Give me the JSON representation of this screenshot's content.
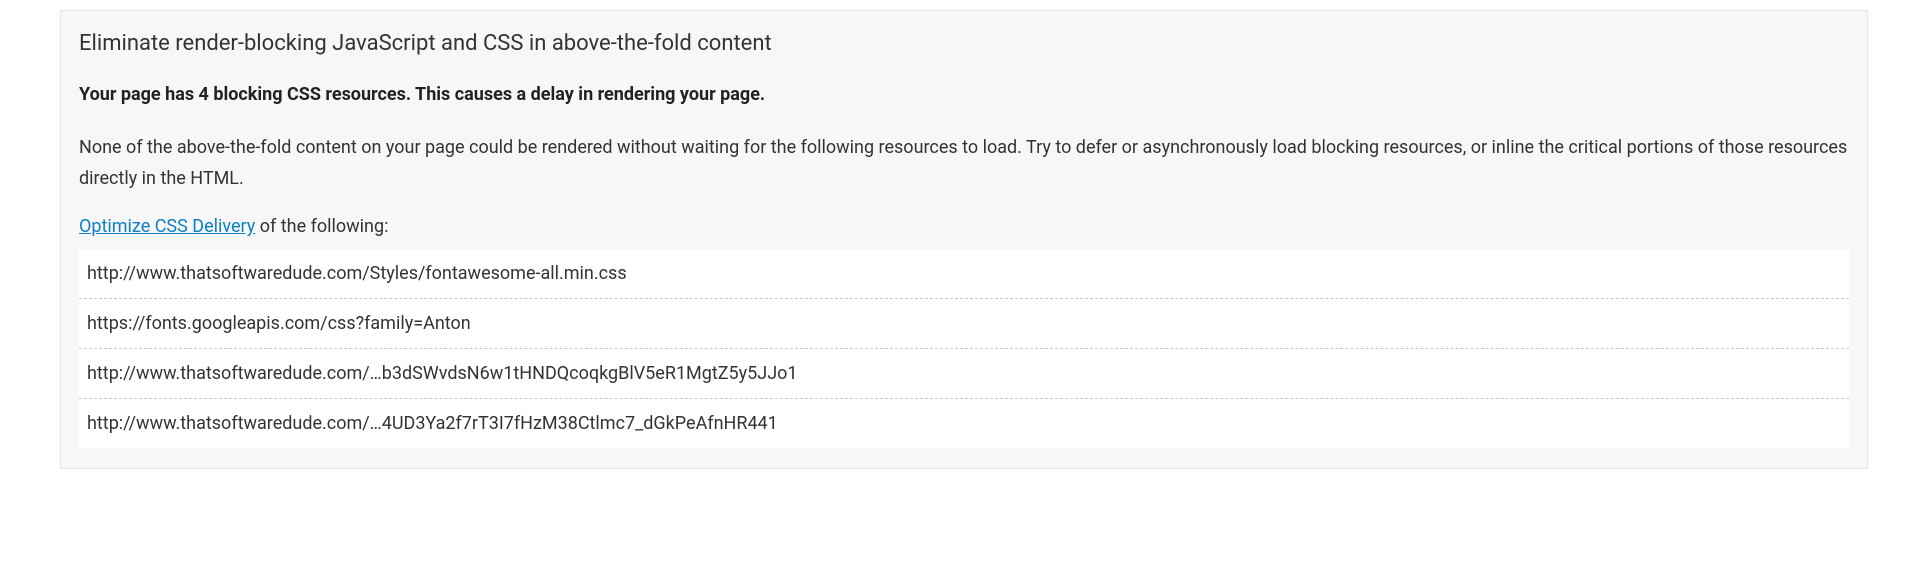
{
  "title": "Eliminate render-blocking JavaScript and CSS in above-the-fold content",
  "subtitle": "Your page has 4 blocking CSS resources. This causes a delay in rendering your page.",
  "description": "None of the above-the-fold content on your page could be rendered without waiting for the following resources to load. Try to defer or asynchronously load blocking resources, or inline the critical portions of those resources directly in the HTML.",
  "optimize_link_text": "Optimize CSS Delivery",
  "optimize_suffix": " of the following:",
  "resources": [
    "http://www.thatsoftwaredude.com/Styles/fontawesome-all.min.css",
    "https://fonts.googleapis.com/css?family=Anton",
    "http://www.thatsoftwaredude.com/…b3dSWvdsN6w1tHNDQcoqkgBlV5eR1MgtZ5y5JJo1",
    "http://www.thatsoftwaredude.com/…4UD3Ya2f7rT3I7fHzM38Ctlmc7_dGkPeAfnHR441"
  ]
}
